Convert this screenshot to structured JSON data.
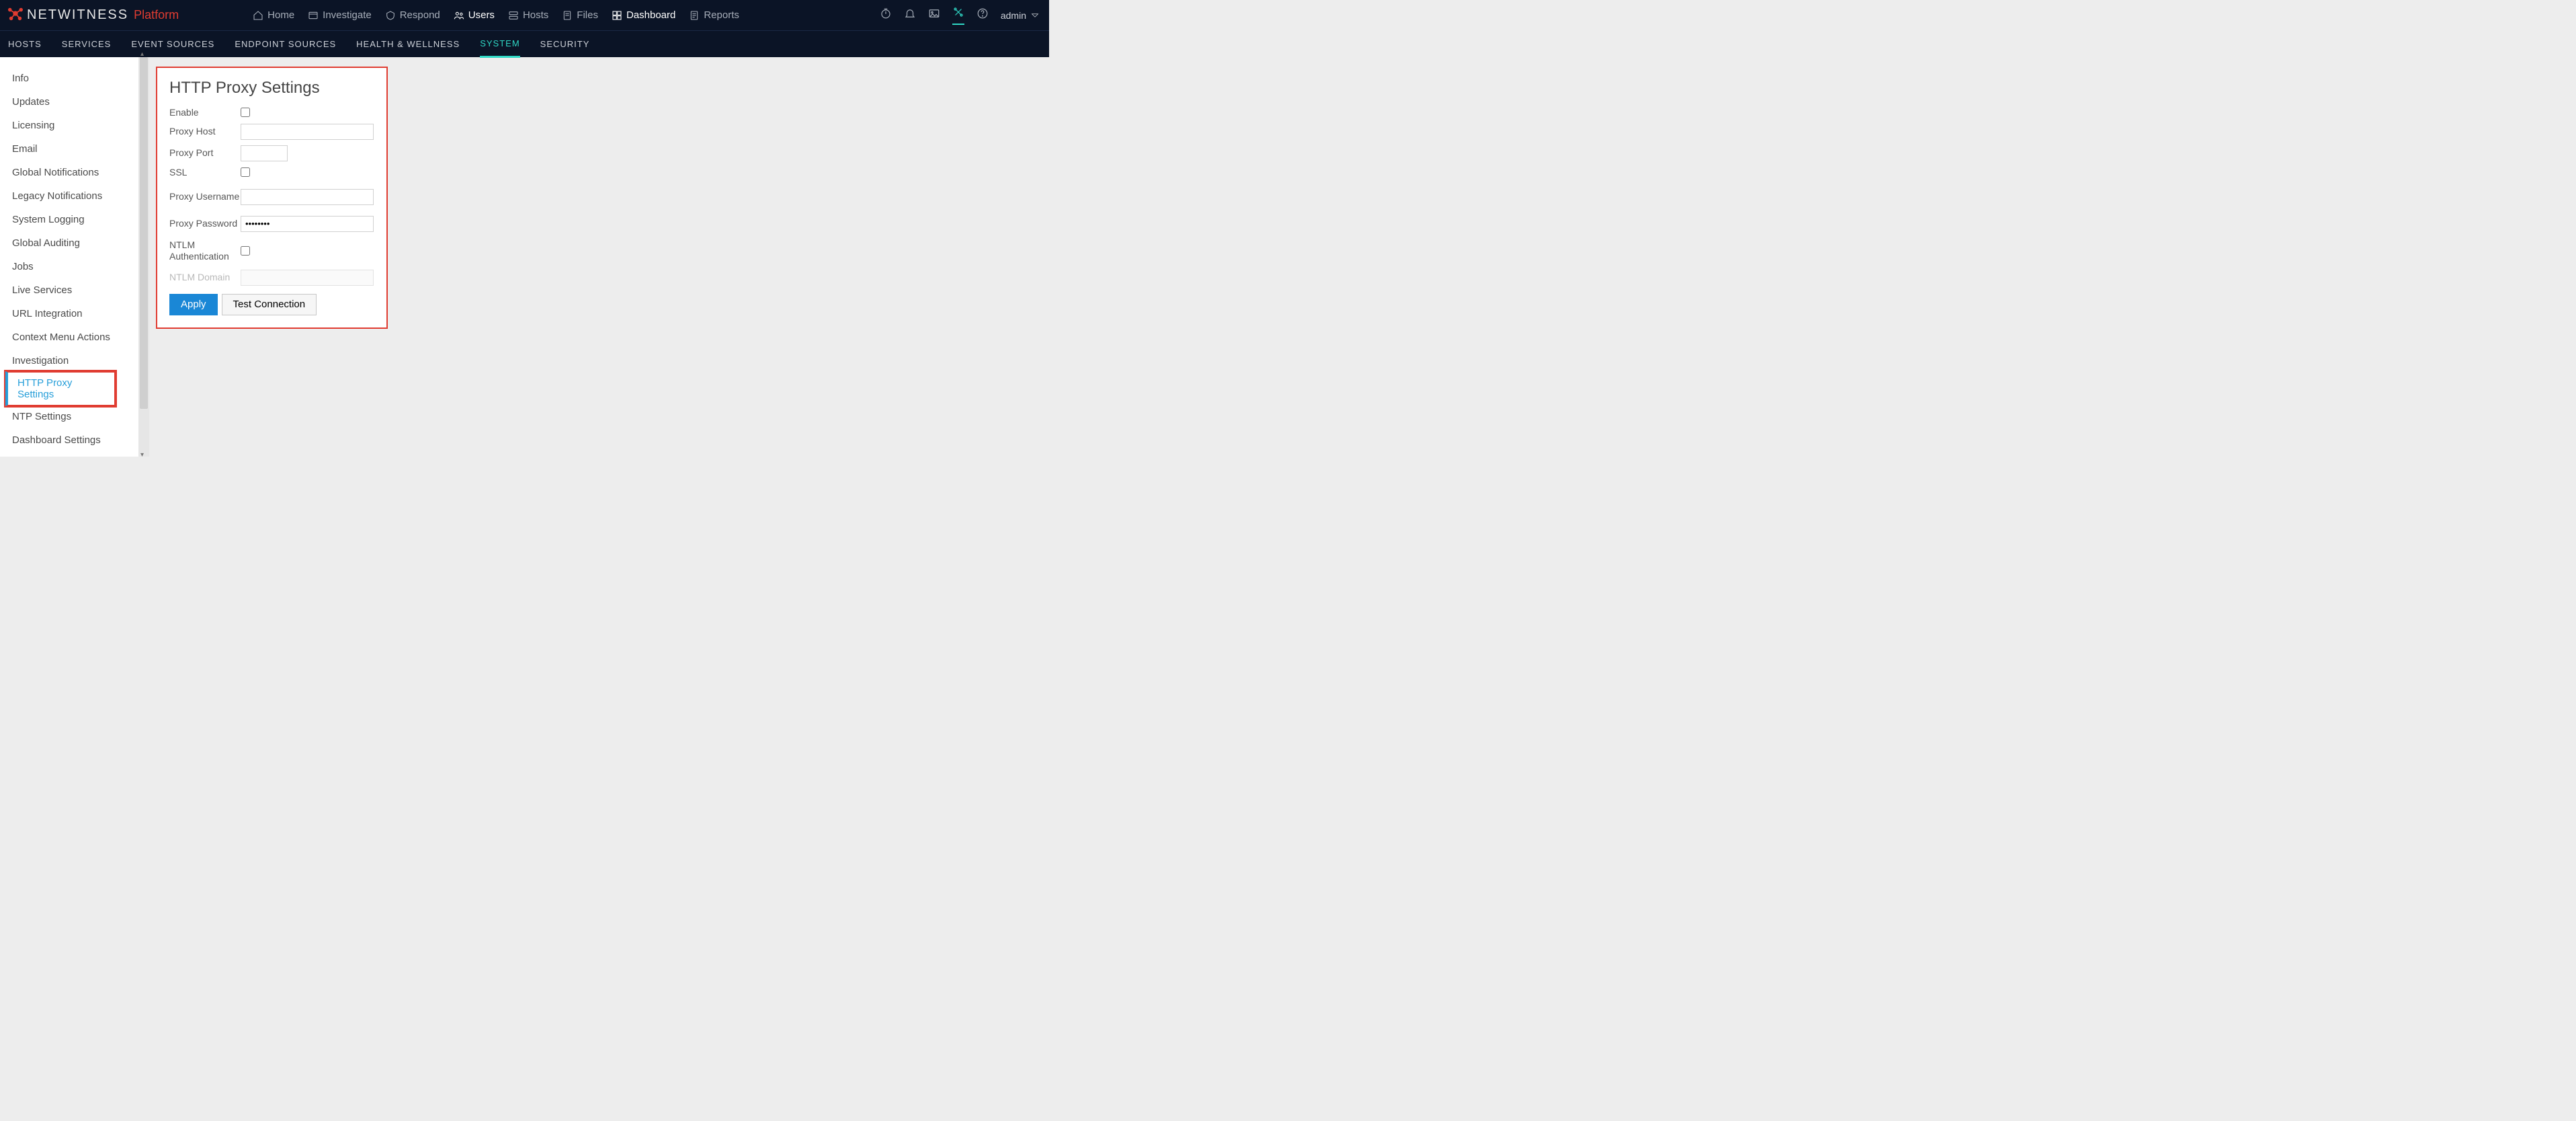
{
  "brand": {
    "name": "NETWITNESS",
    "suffix": "Platform"
  },
  "mainnav": {
    "home": "Home",
    "investigate": "Investigate",
    "respond": "Respond",
    "users": "Users",
    "hosts": "Hosts",
    "files": "Files",
    "dashboard": "Dashboard",
    "reports": "Reports"
  },
  "admin_label": "admin",
  "subnav": {
    "hosts": "HOSTS",
    "services": "SERVICES",
    "event_sources": "EVENT SOURCES",
    "endpoint_sources": "ENDPOINT SOURCES",
    "health": "HEALTH & WELLNESS",
    "system": "SYSTEM",
    "security": "SECURITY"
  },
  "sidebar": {
    "items": [
      "Info",
      "Updates",
      "Licensing",
      "Email",
      "Global Notifications",
      "Legacy Notifications",
      "System Logging",
      "Global Auditing",
      "Jobs",
      "Live Services",
      "URL Integration",
      "Context Menu Actions",
      "Investigation",
      "HTTP Proxy Settings",
      "NTP Settings",
      "Dashboard Settings"
    ],
    "selected_index": 13
  },
  "panel": {
    "title": "HTTP Proxy Settings",
    "enable_label": "Enable",
    "proxy_host_label": "Proxy Host",
    "proxy_port_label": "Proxy Port",
    "ssl_label": "SSL",
    "proxy_username_label": "Proxy Username",
    "proxy_password_label": "Proxy Password",
    "proxy_password_value": "********",
    "ntlm_auth_label": "NTLM Authentication",
    "ntlm_domain_label": "NTLM Domain",
    "apply_btn": "Apply",
    "test_btn": "Test Connection"
  }
}
